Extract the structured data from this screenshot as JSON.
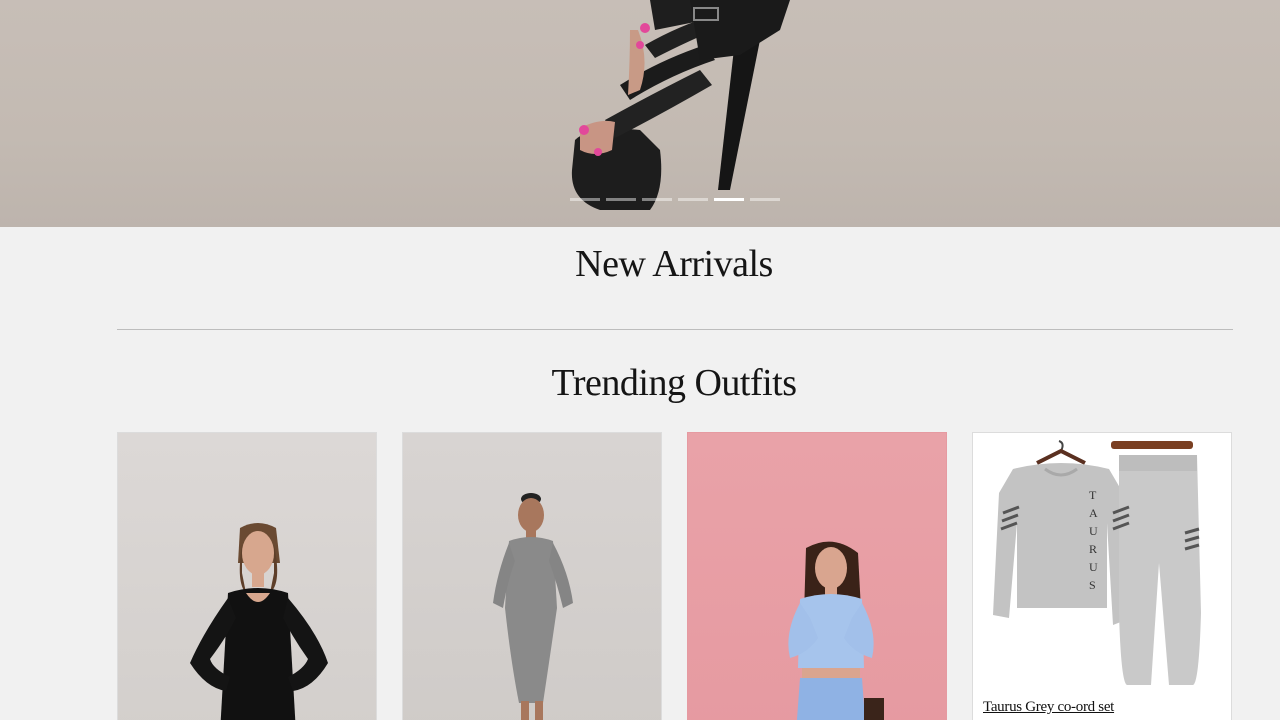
{
  "hero": {
    "slide_count": 6,
    "active_slide": 5
  },
  "sections": {
    "new_arrivals_title": "New Arrivals",
    "trending_title": "Trending Outfits"
  },
  "products": [
    {
      "name": ""
    },
    {
      "name": ""
    },
    {
      "name": ""
    },
    {
      "name": "Taurus Grey co-ord set",
      "print": "TAURUS"
    }
  ]
}
